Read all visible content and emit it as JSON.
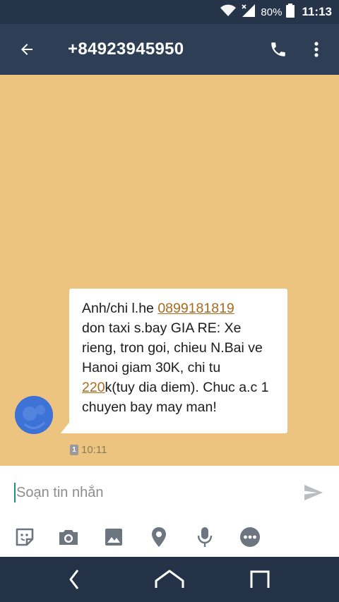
{
  "status_bar": {
    "battery_percent": "80%",
    "time": "11:13",
    "icons": [
      "wifi-icon",
      "signal-icon",
      "battery-icon"
    ]
  },
  "app_bar": {
    "title": "+84923945950",
    "icons": [
      "back-arrow-icon",
      "phone-icon",
      "more-vert-icon"
    ]
  },
  "message": {
    "parts": [
      "Anh/chi l.he ",
      "0899181819",
      "\ndon taxi s.bay GIA RE: Xe rieng, tron goi, chieu N.Bai ve Hanoi giam 30K, chi tu ",
      "220",
      "k(tuy dia diem). Chuc a.c 1 chuyen bay may man!"
    ],
    "sim": "1",
    "time": "10:11"
  },
  "compose": {
    "placeholder": "Soạn tin nhắn",
    "value": ""
  },
  "toolbar": {
    "icons": [
      "sticker-icon",
      "camera-icon",
      "image-icon",
      "location-icon",
      "microphone-icon",
      "more-options-icon"
    ]
  },
  "nav_bar": {
    "icons": [
      "back-icon",
      "home-icon",
      "recents-icon"
    ]
  },
  "colors": {
    "status_bar": "#253449",
    "app_bar": "#2e3e55",
    "conversation_bg": "#edc47f",
    "link": "#a86a1e",
    "caret": "#1e8f86",
    "avatar": "#3d72d6",
    "nav_bar": "#243247"
  }
}
